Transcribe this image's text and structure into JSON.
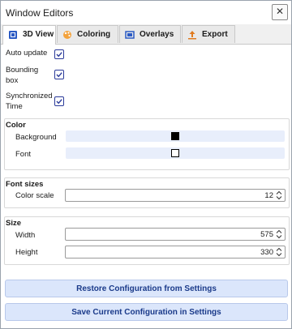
{
  "window": {
    "title": "Window Editors",
    "close_glyph": "✕"
  },
  "tabs": [
    {
      "label": "3D View",
      "icon": "cube-icon",
      "active": true
    },
    {
      "label": "Coloring",
      "icon": "palette-icon"
    },
    {
      "label": "Overlays",
      "icon": "overlay-icon"
    },
    {
      "label": "Export",
      "icon": "export-icon"
    }
  ],
  "options": {
    "auto_update": {
      "label": "Auto update",
      "checked": true
    },
    "bounding_box": {
      "label_line1": "Bounding",
      "label_line2": "box",
      "checked": true
    },
    "synchronized_time": {
      "label_line1": "Synchronized",
      "label_line2": "Time",
      "checked": true
    }
  },
  "color": {
    "title": "Color",
    "background": {
      "label": "Background",
      "value": "#000000"
    },
    "font": {
      "label": "Font",
      "value": "#ffffff"
    }
  },
  "font_sizes": {
    "title": "Font sizes",
    "color_scale": {
      "label": "Color scale",
      "value": "12"
    }
  },
  "size": {
    "title": "Size",
    "width": {
      "label": "Width",
      "value": "575"
    },
    "height": {
      "label": "Height",
      "value": "330"
    }
  },
  "buttons": {
    "restore": "Restore Configuration from Settings",
    "save": "Save Current Configuration in Settings"
  }
}
